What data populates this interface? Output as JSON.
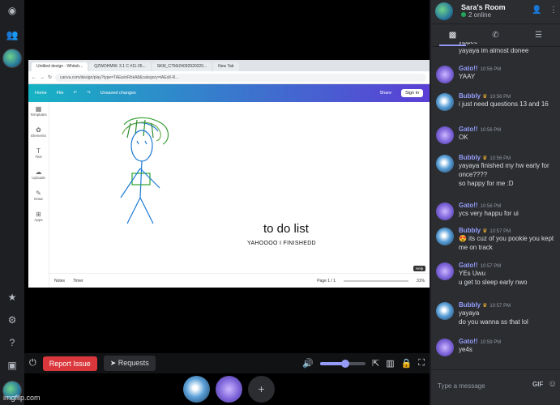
{
  "browser": {
    "tabs": [
      "Untitled design - Whiteb...",
      "QZWOHMW: 3.1 C #11-26...",
      "SKM_C750i24092920220...",
      "New Tab"
    ],
    "url": "canva.com/design/play?type=TAEw/nRhkA8&category=tAEs8-R...",
    "canva": {
      "home": "Home",
      "file": "File",
      "unsaved": "Unsaved changes",
      "share": "Share",
      "signin": "Sign in",
      "side": [
        "Templates",
        "Elements",
        "Text",
        "Uploads",
        "Draw",
        "Apps"
      ],
      "title": "to do list",
      "subtitle": "YAHOOOO I FINISHEDD",
      "notes": "Notes",
      "timer": "Timer",
      "page": "Page 1 / 1",
      "zoom": "31%",
      "help": "Help"
    }
  },
  "controls": {
    "report": "Report Issue",
    "requests": "Requests",
    "volume": 0.55
  },
  "chat": {
    "room": "Sara's Room",
    "online": "2 online",
    "input_placeholder": "Type a message",
    "gif": "GIF",
    "messages": [
      {
        "author": "",
        "time": "",
        "lines": [
          "yippee",
          "yayaya im almost donee"
        ],
        "kind": "bubbly"
      },
      {
        "author": "Gato!!",
        "time": "10:56 PM",
        "lines": [
          "YAAY"
        ],
        "kind": "gato"
      },
      {
        "author": "Bubbly",
        "time": "10:56 PM",
        "lines": [
          "i just need questions 13 and 16"
        ],
        "kind": "bubbly"
      },
      {
        "author": "Gato!!",
        "time": "10:56 PM",
        "lines": [
          "OK"
        ],
        "kind": "gato"
      },
      {
        "author": "Bubbly",
        "time": "10:56 PM",
        "lines": [
          "yayaya finished my hw early for once????",
          "so happy for me :D"
        ],
        "kind": "bubbly"
      },
      {
        "author": "Gato!!",
        "time": "10:56 PM",
        "lines": [
          "ycs very happu for ui"
        ],
        "kind": "gato"
      },
      {
        "author": "Bubbly",
        "time": "10:57 PM",
        "lines": [
          "😍 its cuz of you pookie you kept me on track"
        ],
        "kind": "bubbly"
      },
      {
        "author": "Gato!!",
        "time": "10:57 PM",
        "lines": [
          "YEs Uwu",
          "u get to sleep early nwo"
        ],
        "kind": "gato"
      },
      {
        "author": "Bubbly",
        "time": "10:57 PM",
        "lines": [
          "yayaya",
          "do you wanna ss that lol"
        ],
        "kind": "bubbly"
      },
      {
        "author": "Gato!!",
        "time": "10:59 PM",
        "lines": [
          "ye4s"
        ],
        "kind": "gato"
      }
    ]
  },
  "watermark": "imgflip.com"
}
